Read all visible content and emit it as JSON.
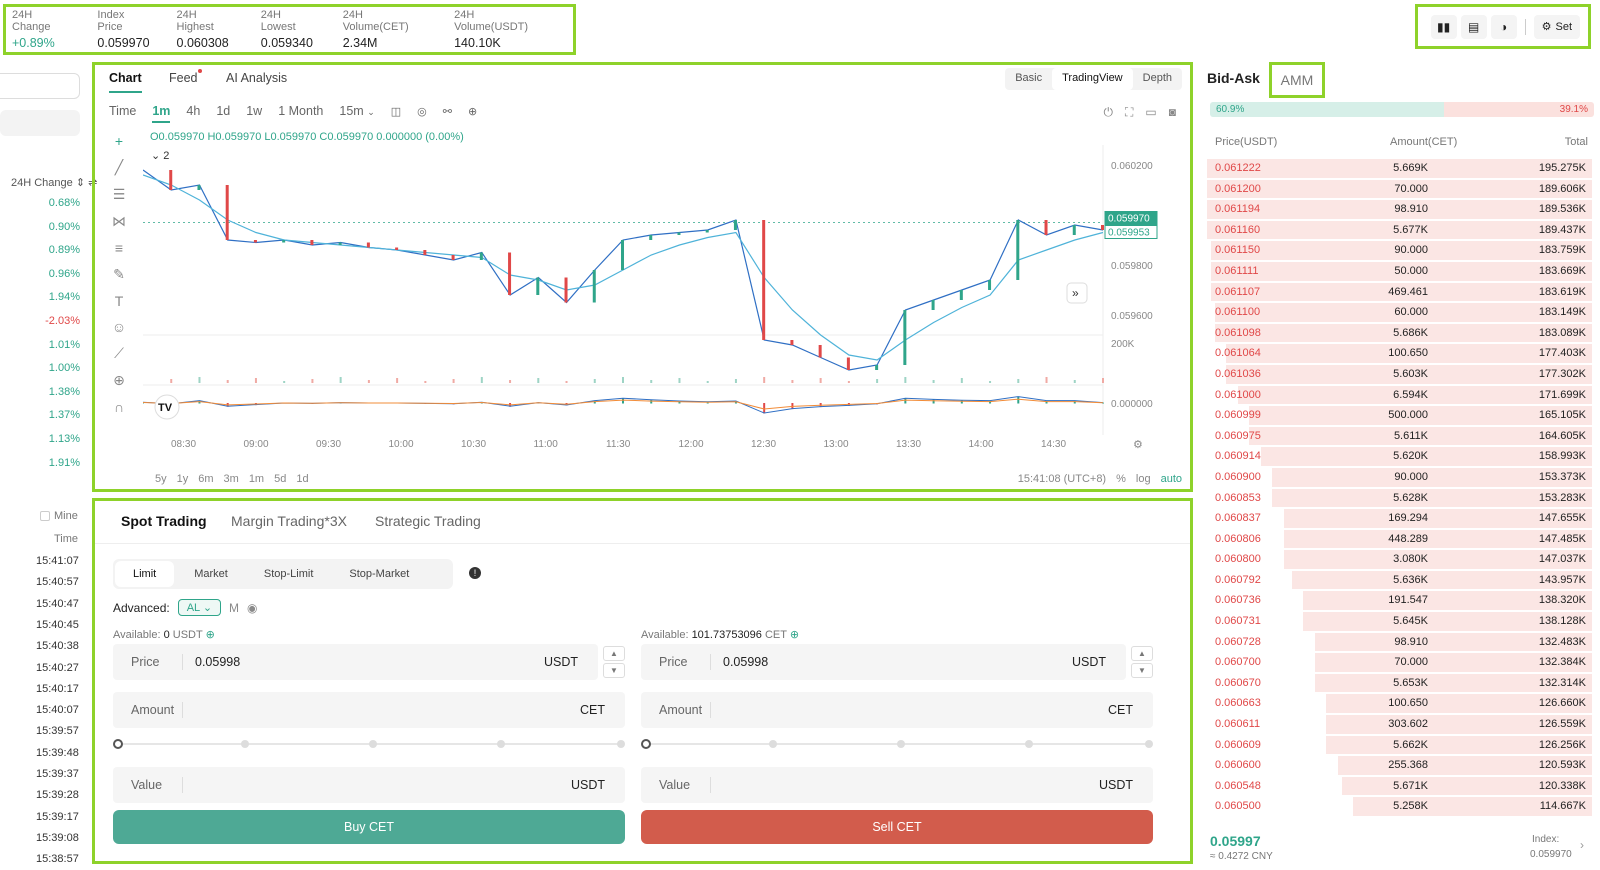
{
  "stats": [
    {
      "label": "24H Change",
      "value": "+0.89%",
      "green": true
    },
    {
      "label": "Index Price",
      "value": "0.059970"
    },
    {
      "label": "24H Highest",
      "value": "0.060308"
    },
    {
      "label": "24H Lowest",
      "value": "0.059340"
    },
    {
      "label": "24H Volume(CET)",
      "value": "2.34M"
    },
    {
      "label": "24H Volume(USDT)",
      "value": "140.10K"
    }
  ],
  "top_icons": {
    "icons": [
      "book-icon",
      "layout-icon",
      "theme-icon"
    ],
    "set_label": "Set"
  },
  "left": {
    "col_header": "24H Change",
    "changes": [
      "0.68%",
      "0.90%",
      "0.89%",
      "0.96%",
      "1.94%",
      "-2.03%",
      "1.01%",
      "1.00%",
      "1.38%",
      "1.37%",
      "1.13%",
      "1.91%"
    ],
    "mine_label": "Mine",
    "time_header": "Time",
    "times": [
      "15:41:07",
      "15:40:57",
      "15:40:47",
      "15:40:45",
      "15:40:38",
      "15:40:27",
      "15:40:17",
      "15:40:07",
      "15:39:57",
      "15:39:48",
      "15:39:37",
      "15:39:28",
      "15:39:17",
      "15:39:08",
      "15:38:57"
    ]
  },
  "chart_panel": {
    "tabs": [
      "Chart",
      "Feed",
      "AI Analysis"
    ],
    "view_tabs": [
      "Basic",
      "TradingView",
      "Depth"
    ],
    "intervals": [
      "Time",
      "1m",
      "4h",
      "1d",
      "1w",
      "1 Month",
      "15m"
    ],
    "ohlc": "O0.059970 H0.059970 L0.059970 C0.059970 0.000000 (0.00%)",
    "indicator_count": "2",
    "range_buttons": [
      "5y",
      "1y",
      "6m",
      "3m",
      "1m",
      "5d",
      "1d"
    ],
    "clock": "15:41:08 (UTC+8)",
    "pct": "%",
    "log": "log",
    "auto": "auto"
  },
  "chart_data": {
    "type": "line",
    "x_ticks": [
      "08:30",
      "09:00",
      "09:30",
      "10:00",
      "10:30",
      "11:00",
      "11:30",
      "12:00",
      "12:30",
      "13:00",
      "13:30",
      "14:00",
      "14:30"
    ],
    "y_ticks": [
      "0.060200",
      "0.060000",
      "0.059800",
      "0.059600"
    ],
    "ylim": [
      0.05956,
      0.06024
    ],
    "price_labels": [
      "0.059970",
      "0.059953"
    ],
    "volume_label": "200K",
    "macd_label": "0.000000",
    "series": [
      {
        "values": [
          0.06018,
          0.0601,
          0.06012,
          0.0599,
          0.05989,
          0.0599,
          0.05988,
          0.05989,
          0.05987,
          0.05986,
          0.05984,
          0.05982,
          0.05985,
          0.05968,
          0.05975,
          0.05965,
          0.05978,
          0.0599,
          0.05992,
          0.05993,
          0.05994,
          0.05998,
          0.0595,
          0.05948,
          0.05943,
          0.05938,
          0.0594,
          0.05962,
          0.05966,
          0.0597,
          0.05974,
          0.05998,
          0.05992,
          0.05996,
          0.05994
        ]
      },
      {
        "values": [
          0.06016,
          0.06012,
          0.06006,
          0.05998,
          0.05993,
          0.0599,
          0.05989,
          0.05988,
          0.05987,
          0.05986,
          0.05985,
          0.05984,
          0.05983,
          0.05976,
          0.05974,
          0.0597,
          0.05972,
          0.05978,
          0.05984,
          0.05988,
          0.05991,
          0.05993,
          0.05975,
          0.05962,
          0.05952,
          0.05944,
          0.05942,
          0.0595,
          0.05957,
          0.05963,
          0.05968,
          0.05982,
          0.05986,
          0.0599,
          0.05993
        ]
      }
    ]
  },
  "trade_panel": {
    "tabs": [
      "Spot Trading",
      "Margin Trading*3X",
      "Strategic Trading"
    ],
    "order_types": [
      "Limit",
      "Market",
      "Stop-Limit",
      "Stop-Market"
    ],
    "advanced_label": "Advanced:",
    "advanced_value": "AL",
    "m_label": "M",
    "buy": {
      "available_label": "Available:",
      "available_value": "0",
      "available_unit": "USDT",
      "price_label": "Price",
      "price_value": "0.05998",
      "price_unit": "USDT",
      "amount_label": "Amount",
      "amount_unit": "CET",
      "value_label": "Value",
      "value_unit": "USDT",
      "button": "Buy CET"
    },
    "sell": {
      "available_label": "Available:",
      "available_value": "101.73753096",
      "available_unit": "CET",
      "price_label": "Price",
      "price_value": "0.05998",
      "price_unit": "USDT",
      "amount_label": "Amount",
      "amount_unit": "CET",
      "value_label": "Value",
      "value_unit": "USDT",
      "button": "Sell CET"
    }
  },
  "orderbook": {
    "title": "Bid-Ask",
    "amm": "AMM",
    "buy_ratio": "60.9%",
    "sell_ratio": "39.1%",
    "buy_fraction": 0.609,
    "headers": [
      "Price(USDT)",
      "Amount(CET)",
      "Total"
    ],
    "rows": [
      {
        "p": "0.061222",
        "a": "5.669K",
        "t": "195.275K",
        "d": 0.0
      },
      {
        "p": "0.061200",
        "a": "70.000",
        "t": "189.606K",
        "d": 0.0
      },
      {
        "p": "0.061194",
        "a": "98.910",
        "t": "189.536K",
        "d": 0.0
      },
      {
        "p": "0.061160",
        "a": "5.677K",
        "t": "189.437K",
        "d": 0.0
      },
      {
        "p": "0.061150",
        "a": "90.000",
        "t": "183.759K",
        "d": 0.01
      },
      {
        "p": "0.061111",
        "a": "50.000",
        "t": "183.669K",
        "d": 0.01
      },
      {
        "p": "0.061107",
        "a": "469.461",
        "t": "183.619K",
        "d": 0.01
      },
      {
        "p": "0.061100",
        "a": "60.000",
        "t": "183.149K",
        "d": 0.02
      },
      {
        "p": "0.061098",
        "a": "5.686K",
        "t": "183.089K",
        "d": 0.02
      },
      {
        "p": "0.061064",
        "a": "100.650",
        "t": "177.403K",
        "d": 0.05
      },
      {
        "p": "0.061036",
        "a": "5.603K",
        "t": "177.302K",
        "d": 0.05
      },
      {
        "p": "0.061000",
        "a": "6.594K",
        "t": "171.699K",
        "d": 0.08
      },
      {
        "p": "0.060999",
        "a": "500.000",
        "t": "165.105K",
        "d": 0.11
      },
      {
        "p": "0.060975",
        "a": "5.611K",
        "t": "164.605K",
        "d": 0.11
      },
      {
        "p": "0.060914",
        "a": "5.620K",
        "t": "158.993K",
        "d": 0.14
      },
      {
        "p": "0.060900",
        "a": "90.000",
        "t": "153.373K",
        "d": 0.17
      },
      {
        "p": "0.060853",
        "a": "5.628K",
        "t": "153.283K",
        "d": 0.17
      },
      {
        "p": "0.060837",
        "a": "169.294",
        "t": "147.655K",
        "d": 0.2
      },
      {
        "p": "0.060806",
        "a": "448.289",
        "t": "147.485K",
        "d": 0.2
      },
      {
        "p": "0.060800",
        "a": "3.080K",
        "t": "147.037K",
        "d": 0.2
      },
      {
        "p": "0.060792",
        "a": "5.636K",
        "t": "143.957K",
        "d": 0.22
      },
      {
        "p": "0.060736",
        "a": "191.547",
        "t": "138.320K",
        "d": 0.25
      },
      {
        "p": "0.060731",
        "a": "5.645K",
        "t": "138.128K",
        "d": 0.25
      },
      {
        "p": "0.060728",
        "a": "98.910",
        "t": "132.483K",
        "d": 0.28
      },
      {
        "p": "0.060700",
        "a": "70.000",
        "t": "132.384K",
        "d": 0.28
      },
      {
        "p": "0.060670",
        "a": "5.653K",
        "t": "132.314K",
        "d": 0.28
      },
      {
        "p": "0.060663",
        "a": "100.650",
        "t": "126.660K",
        "d": 0.31
      },
      {
        "p": "0.060611",
        "a": "303.602",
        "t": "126.559K",
        "d": 0.31
      },
      {
        "p": "0.060609",
        "a": "5.662K",
        "t": "126.256K",
        "d": 0.31
      },
      {
        "p": "0.060600",
        "a": "255.368",
        "t": "120.593K",
        "d": 0.34
      },
      {
        "p": "0.060548",
        "a": "5.671K",
        "t": "120.338K",
        "d": 0.35
      },
      {
        "p": "0.060500",
        "a": "5.258K",
        "t": "114.667K",
        "d": 0.38
      }
    ],
    "last_price": "0.05997",
    "last_cny": "≈ 0.4272 CNY",
    "index_label": "Index:",
    "index_value": "0.059970"
  },
  "colors": {
    "accent": "#2fa58a",
    "down": "#e04848",
    "highlight": "#8ed22a"
  }
}
